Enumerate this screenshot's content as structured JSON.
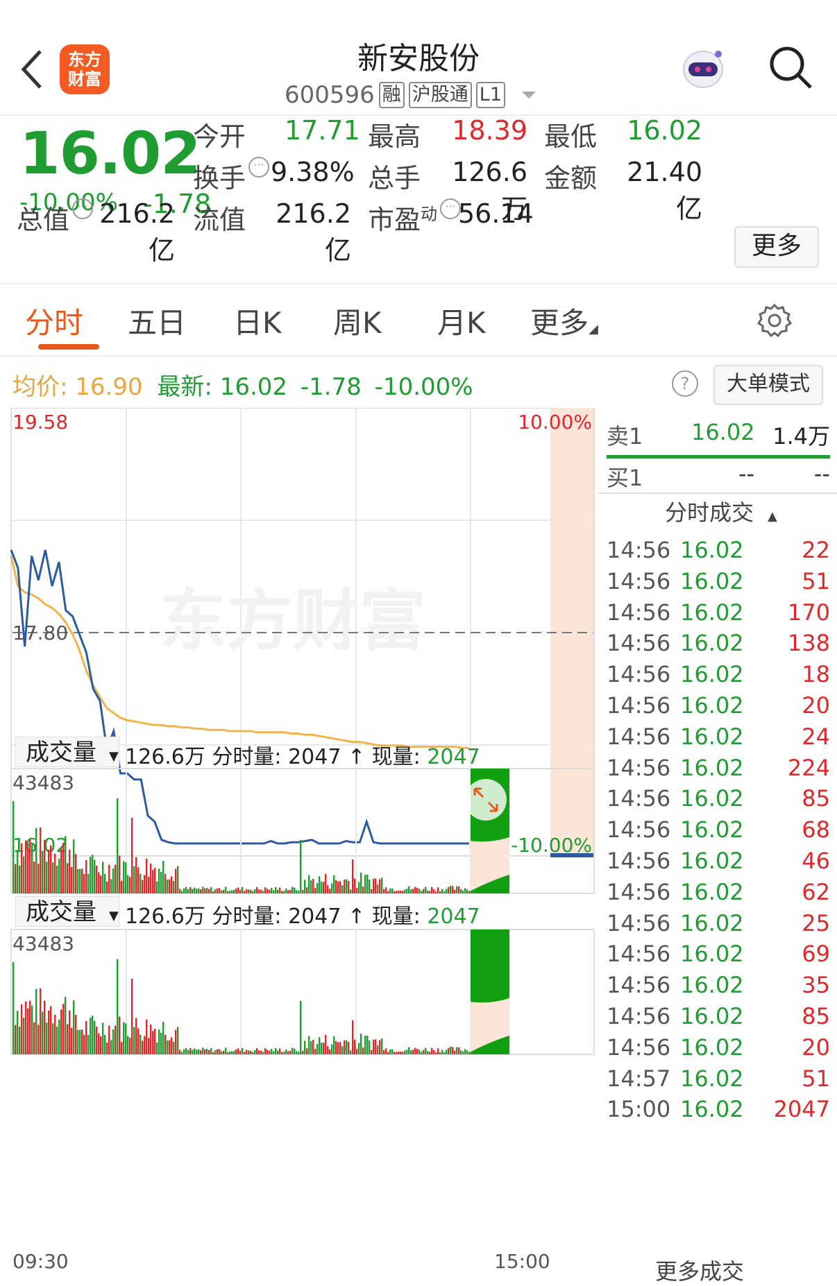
{
  "header": {
    "title": "新安股份",
    "code": "600596",
    "tags": [
      "融",
      "沪股通",
      "L1"
    ],
    "logo_text": "东方\n财富"
  },
  "quote": {
    "price": "16.02",
    "change_pct": "-10.00%",
    "change": "-1.78",
    "fields": [
      {
        "label": "今开",
        "value": "17.71",
        "color": "green"
      },
      {
        "label": "最高",
        "value": "18.39",
        "color": "red"
      },
      {
        "label": "最低",
        "value": "16.02",
        "color": "green"
      },
      {
        "label": "换手",
        "value": "9.38%",
        "color": "black"
      },
      {
        "label": "总手",
        "value": "126.6万",
        "color": "black"
      },
      {
        "label": "金额",
        "value": "21.40亿",
        "color": "black"
      },
      {
        "label": "总值",
        "value": "216.2亿",
        "color": "black"
      },
      {
        "label": "流值",
        "value": "216.2亿",
        "color": "black"
      },
      {
        "label": "市盈",
        "value": "56.14",
        "color": "black"
      }
    ],
    "pe_superscript": "动",
    "more_label": "更多"
  },
  "tabs": [
    "分时",
    "五日",
    "日K",
    "周K",
    "月K",
    "更多"
  ],
  "info": {
    "avg_label": "均价:",
    "avg_value": "16.90",
    "latest_label": "最新:",
    "latest_value": "16.02",
    "latest_change": "-1.78",
    "latest_pct": "-10.00%",
    "help": "?",
    "big_order_label": "大单模式"
  },
  "chart_data": {
    "type": "line",
    "y_max": "19.58",
    "y_min": "16.02",
    "y_ref": "17.80",
    "pct_max": "10.00%",
    "pct_min": "-10.00%",
    "watermark": "东方财富",
    "x_start": "09:30",
    "x_end": "15:00",
    "ylim": [
      16.02,
      19.58
    ],
    "series": [
      {
        "values": [
          18.45,
          18.3,
          17.65,
          18.4,
          18.2,
          18.45,
          18.15,
          18.35,
          17.95,
          17.9,
          17.75,
          17.6,
          17.3,
          17.2,
          16.8,
          16.95,
          16.6,
          16.6,
          16.55,
          16.55,
          16.25,
          16.2,
          16.05,
          16.03,
          16.02,
          16.02,
          16.02,
          16.02,
          16.02,
          16.02,
          16.02,
          16.02,
          16.02,
          16.02,
          16.02,
          16.02,
          16.02,
          16.02,
          16.04,
          16.02,
          16.02,
          16.03,
          16.03,
          16.04,
          16.05,
          16.02,
          16.02,
          16.02,
          16.02,
          16.04,
          16.03,
          16.03,
          16.2,
          16.03,
          16.02,
          16.02,
          16.02,
          16.02,
          16.02,
          16.02,
          16.02,
          16.02,
          16.02,
          16.02,
          16.02,
          16.02,
          16.02,
          16.02
        ]
      },
      {
        "values": [
          18.4,
          18.15,
          18.1,
          18.08,
          18.05,
          18.0,
          17.97,
          17.92,
          17.85,
          17.75,
          17.62,
          17.45,
          17.33,
          17.23,
          17.14,
          17.1,
          17.06,
          17.04,
          17.03,
          17.02,
          17.01,
          17.0,
          17.0,
          16.99,
          16.99,
          16.98,
          16.98,
          16.97,
          16.97,
          16.96,
          16.96,
          16.96,
          16.95,
          16.95,
          16.95,
          16.95,
          16.94,
          16.94,
          16.94,
          16.94,
          16.94,
          16.93,
          16.93,
          16.92,
          16.92,
          16.91,
          16.9,
          16.89,
          16.88,
          16.87,
          16.86,
          16.86,
          16.85,
          16.84,
          16.83,
          16.83,
          16.83,
          16.83,
          16.82,
          16.82,
          16.82,
          16.82,
          16.82,
          16.82,
          16.82,
          16.82,
          16.81,
          16.81
        ]
      }
    ]
  },
  "volume": {
    "selector": "成交量",
    "total": "126.6万",
    "minute_label": "分时量: 2047",
    "now_label": "现量:",
    "now_value": "2047",
    "y_max": "43483",
    "bars": [
      [
        0.95,
        1,
        0.4,
        0.2
      ],
      [
        0.5,
        1,
        0.25,
        0.2
      ],
      [
        0.3,
        1,
        0.45,
        0.2
      ],
      [
        0.7,
        -1,
        0.3,
        0.2
      ],
      [
        0.35,
        1,
        0.2,
        0.2
      ],
      [
        0.25,
        -1,
        0.5,
        0.2
      ],
      [
        0.6,
        1,
        0.25,
        0.2
      ],
      [
        0.2,
        1,
        0.55,
        0.2
      ],
      [
        0.45,
        -1,
        0.2,
        0.2
      ],
      [
        0.3,
        1,
        0.35,
        0.2
      ],
      [
        0.25,
        -1,
        0.25,
        0.2
      ],
      [
        0.62,
        1,
        0.3,
        0.2
      ],
      [
        0.2,
        -1,
        0.2,
        0.2
      ],
      [
        0.48,
        1,
        0.22,
        0.2
      ],
      [
        0.22,
        -1,
        0.18,
        0.2
      ],
      [
        0.92,
        1,
        0.35,
        0.2
      ],
      [
        0.2,
        -1,
        0.25,
        0.2
      ],
      [
        0.68,
        1,
        0.22,
        0.2
      ],
      [
        0.32,
        -1,
        0.2,
        0.2
      ],
      [
        0.22,
        1,
        0.5,
        0.2
      ],
      [
        0.18,
        -1,
        0.16,
        0.2
      ],
      [
        0.12,
        1,
        0.14,
        0.2
      ],
      [
        0.1,
        -1,
        0.1,
        0.2
      ],
      [
        0.08,
        1,
        0.1,
        0.2
      ]
    ]
  },
  "trades": {
    "sell_label": "卖1",
    "sell_price": "16.02",
    "sell_vol": "1.4万",
    "buy_label": "买1",
    "buy_price": "--",
    "buy_vol": "--",
    "title": "分时成交",
    "rows": [
      {
        "time": "14:56",
        "price": "16.02",
        "vol": "22"
      },
      {
        "time": "14:56",
        "price": "16.02",
        "vol": "51"
      },
      {
        "time": "14:56",
        "price": "16.02",
        "vol": "170"
      },
      {
        "time": "14:56",
        "price": "16.02",
        "vol": "138"
      },
      {
        "time": "14:56",
        "price": "16.02",
        "vol": "18"
      },
      {
        "time": "14:56",
        "price": "16.02",
        "vol": "20"
      },
      {
        "time": "14:56",
        "price": "16.02",
        "vol": "24"
      },
      {
        "time": "14:56",
        "price": "16.02",
        "vol": "224"
      },
      {
        "time": "14:56",
        "price": "16.02",
        "vol": "85"
      },
      {
        "time": "14:56",
        "price": "16.02",
        "vol": "68"
      },
      {
        "time": "14:56",
        "price": "16.02",
        "vol": "46"
      },
      {
        "time": "14:56",
        "price": "16.02",
        "vol": "62"
      },
      {
        "time": "14:56",
        "price": "16.02",
        "vol": "25"
      },
      {
        "time": "14:56",
        "price": "16.02",
        "vol": "69"
      },
      {
        "time": "14:56",
        "price": "16.02",
        "vol": "35"
      },
      {
        "time": "14:56",
        "price": "16.02",
        "vol": "85"
      },
      {
        "time": "14:56",
        "price": "16.02",
        "vol": "20"
      },
      {
        "time": "14:57",
        "price": "16.02",
        "vol": "51"
      },
      {
        "time": "15:00",
        "price": "16.02",
        "vol": "2047"
      }
    ],
    "more_label": "更多成交"
  },
  "colors": {
    "green": "#1f9d32",
    "red": "#e0282c",
    "orange": "#e95a1a",
    "avg_line": "#f0b44a",
    "price_line": "#2c5aa0"
  }
}
